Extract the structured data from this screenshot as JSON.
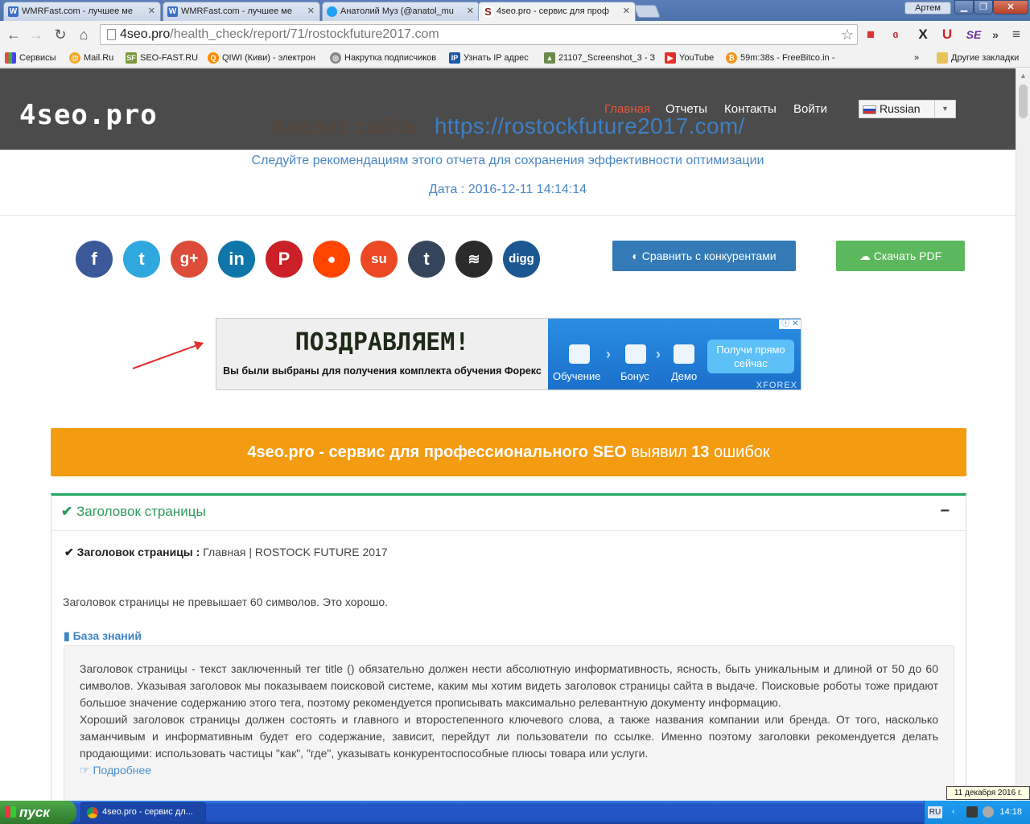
{
  "browser": {
    "tabs": [
      {
        "title": "WMRFast.com - лучшее ме",
        "favicon": "W"
      },
      {
        "title": "WMRFast.com - лучшее ме",
        "favicon": "W"
      },
      {
        "title": "Анатолий Муз (@anatol_mu",
        "favicon": "twitter-bird"
      },
      {
        "title": "4seo.pro - сервис для проф",
        "favicon": "S"
      }
    ],
    "profile_name": "Артем",
    "url_host": "4seo.pro",
    "url_path": "/health_check/report/71/rostockfuture2017.com",
    "bookmarks": [
      "Сервисы",
      "Mail.Ru",
      "SEO-FAST.RU",
      "QIWI (Киви) - электрон",
      "Накрутка подписчиков",
      "Узнать IP адрес",
      "21107_Screenshot_3 - З",
      "YouTube",
      "59m:38s - FreeBitco.in -",
      "Другие закладки"
    ],
    "bookmarks_overflow": "»"
  },
  "site": {
    "logo": "4seo.pro",
    "nav": [
      "Главная",
      "Отчеты",
      "Контакты",
      "Войти"
    ],
    "language": "Russian",
    "analysis_label": "Анализ сайта : ",
    "analysis_url": "https://rostockfuture2017.com/",
    "subtitle": "Следуйте рекомендациям этого отчета для сохранения эффективности оптимизации",
    "date": "Дата : 2016-12-11 14:14:14",
    "social": [
      "facebook",
      "twitter",
      "google-plus",
      "linkedin",
      "pinterest",
      "reddit",
      "stumbleupon",
      "tumblr",
      "buffer",
      "digg"
    ],
    "compare_button": "Сравнить с конкурентами",
    "pdf_button": "Скачать PDF",
    "colors": {
      "header_bg": "#4b4b4b",
      "nav_active": "#e8553a",
      "banner": "#f39c12",
      "ok_green": "#21a560",
      "compare": "#337ab7",
      "pdf": "#5cb85c"
    }
  },
  "ad": {
    "headline": "ПОЗДРАВЛЯЕМ!",
    "text": "Вы были выбраны для получения комплекта обучения Форекс",
    "steps": [
      "Обучение",
      "Бонус",
      "Демо"
    ],
    "cta": "Получи прямо сейчас",
    "brand": "XFOREX"
  },
  "banner": {
    "part1": "4seo.pro - сервис для профессионального SEO",
    "part2": " выявил ",
    "count": "13",
    "part3": " ошибок"
  },
  "panel": {
    "title": "Заголовок страницы",
    "collapse": "−",
    "key": "Заголовок страницы :",
    "value": "Главная | ROSTOCK FUTURE 2017",
    "message": "Заголовок страницы не превышает 60 символов. Это хорошо.",
    "kb_label": "База знаний",
    "kb_p1": "Заголовок страницы - текст заключенный тег title () обязательно должен нести абсолютную информативность, ясность, быть уникальным и длиной от 50 до 60 символов. Указывая заголовок мы показываем поисковой системе, каким мы хотим видеть заголовок страницы сайта в выдаче. Поисковые роботы тоже придают большое значение содержанию этого тега, поэтому рекомендуется прописывать максимально релевантную документу информацию.",
    "kb_p2": "Хороший заголовок страницы должен состоять и главного и второстепенного ключевого слова, а также названия компании или бренда. От того, насколько заманчивым и информативным будет его содержание, зависит, перейдут ли пользователи по ссылке. Именно поэтому заголовки рекомендуется делать продающими: использовать частицы \"как\", \"где\", указывать конкурентоспособные плюсы товара или услуги.",
    "more": "Подробнее"
  },
  "taskbar": {
    "start": "пуск",
    "window": "4seo.pro - сервис дл...",
    "lang": "RU",
    "time": "14:18",
    "tooltip": "11 декабря 2016 г."
  }
}
